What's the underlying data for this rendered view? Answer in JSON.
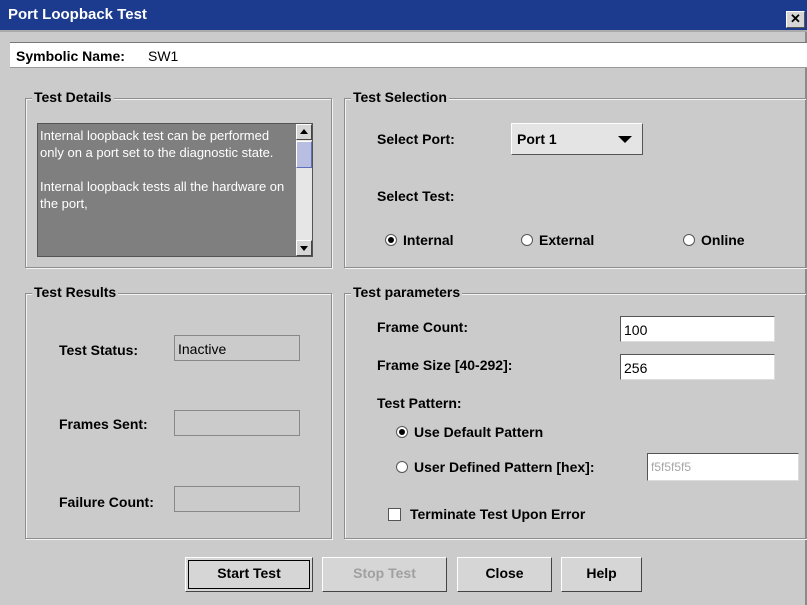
{
  "window": {
    "title": "Port Loopback Test",
    "close_glyph": "✕"
  },
  "symbolic": {
    "label": "Symbolic Name:",
    "value": "SW1"
  },
  "test_details": {
    "title": "Test Details",
    "paragraph1": "Internal loopback test can be performed only on a port set to the diagnostic state.",
    "paragraph2": "Internal loopback tests all the hardware on the port,"
  },
  "test_selection": {
    "title": "Test Selection",
    "select_port_label": "Select Port:",
    "port_value": "Port 1",
    "select_test_label": "Select Test:",
    "options": [
      {
        "label": "Internal",
        "selected": true
      },
      {
        "label": "External",
        "selected": false
      },
      {
        "label": "Online",
        "selected": false
      }
    ]
  },
  "test_results": {
    "title": "Test Results",
    "status_label": "Test Status:",
    "status_value": "Inactive",
    "frames_sent_label": "Frames Sent:",
    "frames_sent_value": "",
    "failure_count_label": "Failure Count:",
    "failure_count_value": ""
  },
  "test_parameters": {
    "title": "Test parameters",
    "frame_count_label": "Frame Count:",
    "frame_count_value": "100",
    "frame_size_label": "Frame Size [40-292]:",
    "frame_size_value": "256",
    "pattern_label": "Test Pattern:",
    "default_pattern_label": "Use Default Pattern",
    "user_pattern_label": "User Defined Pattern [hex]:",
    "user_pattern_value": "f5f5f5f5",
    "terminate_label": "Terminate Test Upon Error"
  },
  "buttons": {
    "start": "Start Test",
    "stop": "Stop Test",
    "close": "Close",
    "help": "Help"
  }
}
